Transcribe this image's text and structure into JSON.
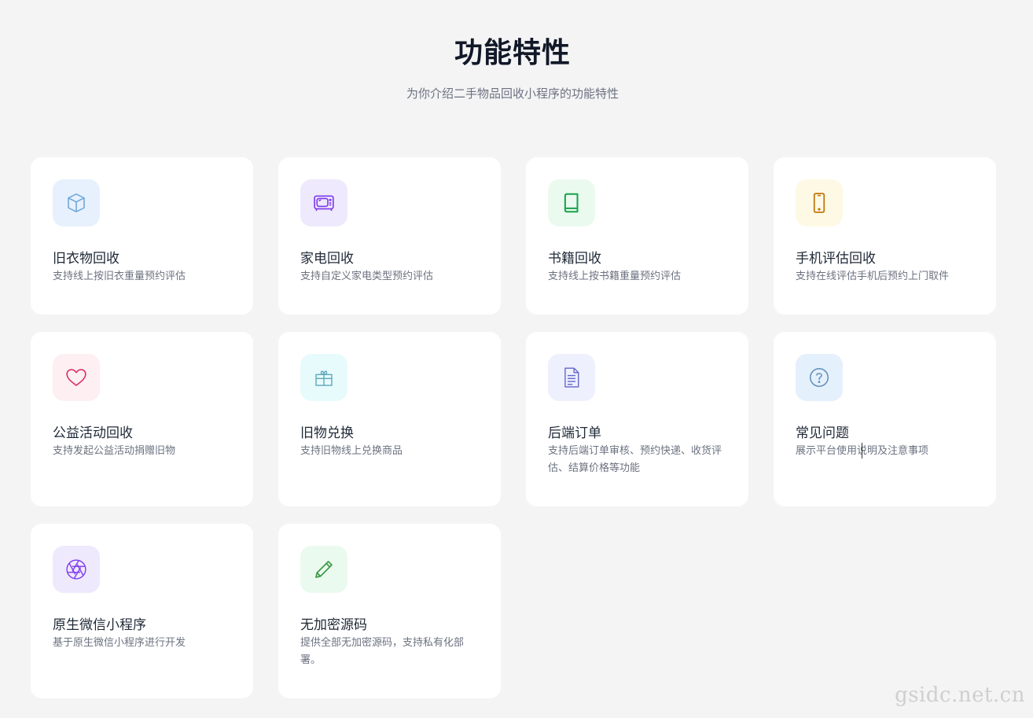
{
  "header": {
    "title": "功能特性",
    "subtitle": "为你介绍二手物品回收小程序的功能特性"
  },
  "features": [
    {
      "title": "旧衣物回收",
      "desc": "支持线上按旧衣重量预约评估",
      "icon": "box-icon",
      "icon_color": "#6aa3d8",
      "bg": "#e6f1fd"
    },
    {
      "title": "家电回收",
      "desc": "支持自定义家电类型预约评估",
      "icon": "tv-icon",
      "icon_color": "#7c3aed",
      "bg": "#efe9fd"
    },
    {
      "title": "书籍回收",
      "desc": "支持线上按书籍重量预约评估",
      "icon": "book-icon",
      "icon_color": "#16a34a",
      "bg": "#ebfaef"
    },
    {
      "title": "手机评估回收",
      "desc": "支持在线评估手机后预约上门取件",
      "icon": "phone-icon",
      "icon_color": "#c2750c",
      "bg": "#fef9e5"
    },
    {
      "title": "公益活动回收",
      "desc": "支持发起公益活动捐赠旧物",
      "icon": "heart-icon",
      "icon_color": "#db2763",
      "bg": "#fdeff2"
    },
    {
      "title": "旧物兑换",
      "desc": "支持旧物线上兑换商品",
      "icon": "gift-icon",
      "icon_color": "#5ba7b8",
      "bg": "#e8fbfc"
    },
    {
      "title": "后端订单",
      "desc": "支持后端订单审核、预约快递、收货评估、结算价格等功能",
      "icon": "document-icon",
      "icon_color": "#6366c8",
      "bg": "#eef0fe"
    },
    {
      "title": "常见问题",
      "desc": "展示平台使用说明及注意事项",
      "icon": "help-icon",
      "icon_color": "#5f8fb8",
      "bg": "#e5f0fd"
    },
    {
      "title": "原生微信小程序",
      "desc": "基于原生微信小程序进行开发",
      "icon": "aperture-icon",
      "icon_color": "#7c3aed",
      "bg": "#efe9fd"
    },
    {
      "title": "无加密源码",
      "desc": "提供全部无加密源码，支持私有化部署。",
      "icon": "pencil-icon",
      "icon_color": "#3f9a4a",
      "bg": "#ebfaef"
    }
  ],
  "watermark": "gsidc.net.cn"
}
